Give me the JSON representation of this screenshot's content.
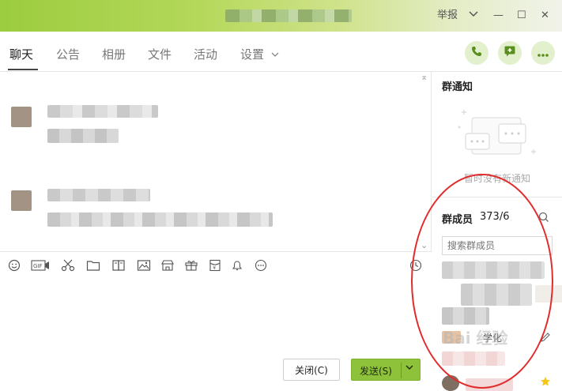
{
  "window": {
    "report_label": "举报",
    "minimize_glyph": "—",
    "maximize_glyph": "☐",
    "close_glyph": "✕"
  },
  "tabs": [
    {
      "label": "聊天",
      "active": true
    },
    {
      "label": "公告"
    },
    {
      "label": "相册"
    },
    {
      "label": "文件"
    },
    {
      "label": "活动"
    },
    {
      "label": "设置"
    }
  ],
  "header_actions": [
    "phone-icon",
    "add-message-icon",
    "more-icon"
  ],
  "toolbar_icons": [
    "emoji-icon",
    "gif-icon",
    "scissors-icon",
    "folder-icon",
    "picture-frame-icon",
    "image-icon",
    "shop-icon",
    "gift-icon",
    "red-packet-icon",
    "bell-icon",
    "more-circle-icon",
    "history-clock-icon"
  ],
  "buttons": {
    "close_label": "关闭(C)",
    "send_label": "发送(S)"
  },
  "notice": {
    "title": "群通知",
    "empty_text": "暂时没有新通知"
  },
  "members": {
    "title": "群成员",
    "count": "373/6",
    "search_placeholder": "搜索群成员",
    "visible_name": "学化"
  },
  "colors": {
    "accent": "#8fc23b",
    "annotation": "#e22b2b"
  },
  "watermark": "Bai 经验"
}
